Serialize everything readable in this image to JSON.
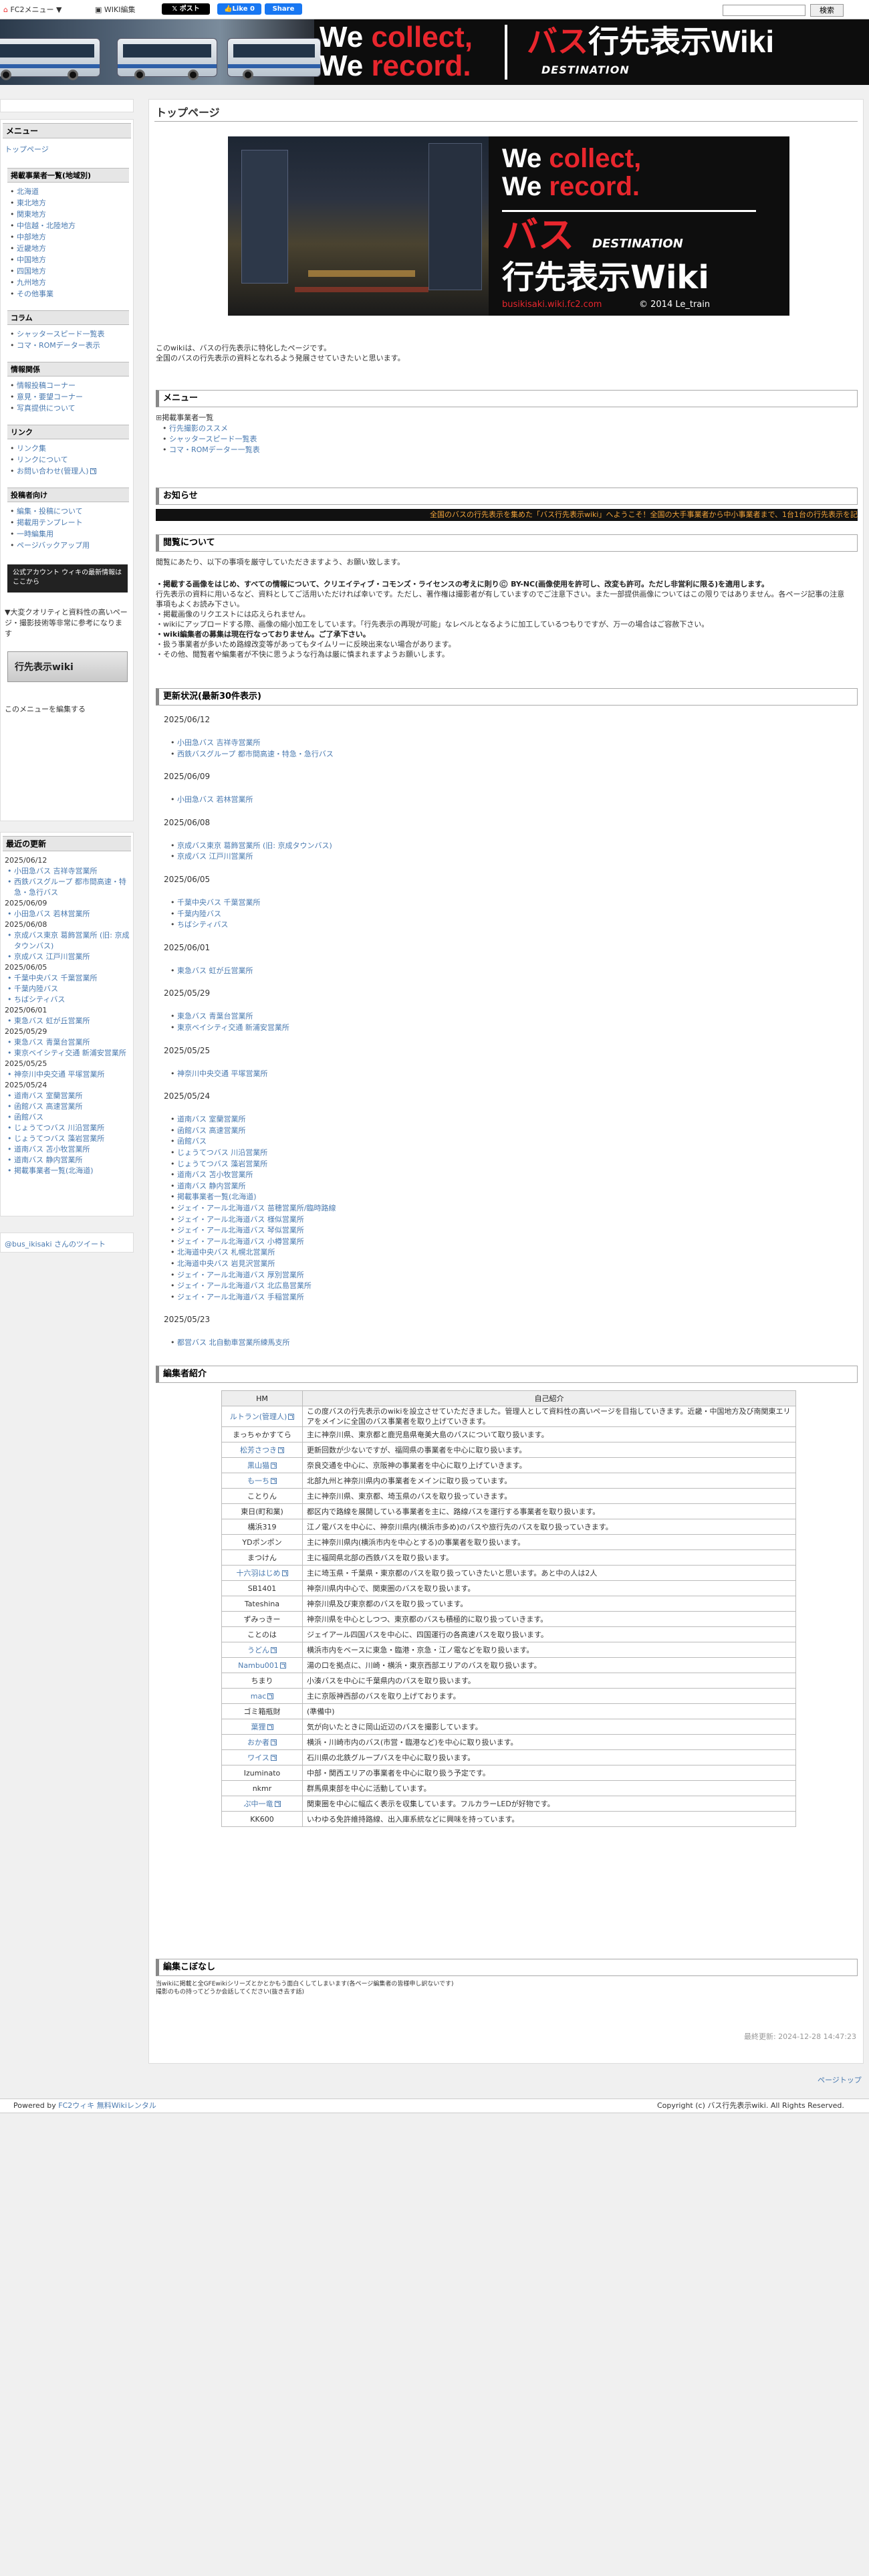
{
  "topbar": {
    "fc2_menu": "FC2メニュー ▼",
    "wiki_edit": "WIKI編集",
    "post_btn": "ポスト",
    "like_btn": "Like 0",
    "share_btn": "Share",
    "search_button": "検索"
  },
  "banner": {
    "line1a": "We ",
    "line1b": "collect,",
    "line2a": "We ",
    "line2b": "record.",
    "title1": "バス",
    "title2": "行先表示Wiki",
    "subtitle": "DESTINATION"
  },
  "sidebar": {
    "menu_heading": "メニュー",
    "top_link": "トップページ",
    "sec_region": "掲載事業者一覧(地域別)",
    "regions": [
      "北海道",
      "東北地方",
      "関東地方",
      "中信越・北陸地方",
      "中部地方",
      "近畿地方",
      "中国地方",
      "四国地方",
      "九州地方",
      "その他事業"
    ],
    "sec_column": "コラム",
    "columns": [
      "シャッタースピード一覧表",
      "コマ・ROMデーター表示"
    ],
    "sec_info": "情報関係",
    "info": [
      "情報投稿コーナー",
      "意見・要望コーナー",
      "写真提供について"
    ],
    "sec_link": "リンク",
    "links": [
      "リンク集",
      "リンクについて",
      "お問い合わせ(管理人)"
    ],
    "sec_edit": "投稿者向け",
    "edit": [
      "編集・投稿について",
      "掲載用テンプレート",
      "一時編集用",
      "ページバックアップ用"
    ],
    "twitter_banner": "公式アカウント ウィキの最新情報はここから",
    "quality_text": "▼大変クオリティと資料性の高いページ・撮影技術等非常に参考になります",
    "wiki_banner": "行先表示wiki",
    "edit_menu": "このメニューを編集する",
    "recent_heading": "最近の更新",
    "recent": [
      {
        "date": "2025/06/12",
        "items": [
          "小田急バス 吉祥寺営業所",
          "西鉄バスグループ 都市間高速・特急・急行バス"
        ]
      },
      {
        "date": "2025/06/09",
        "items": [
          "小田急バス 若林営業所"
        ]
      },
      {
        "date": "2025/06/08",
        "items": [
          "京成バス東京 葛飾営業所 (旧: 京成タウンバス)",
          "京成バス 江戸川営業所"
        ]
      },
      {
        "date": "2025/06/05",
        "items": [
          "千葉中央バス 千葉営業所",
          "千葉内陸バス",
          "ちばシティバス"
        ]
      },
      {
        "date": "2025/06/01",
        "items": [
          "東急バス 虹が丘営業所"
        ]
      },
      {
        "date": "2025/05/29",
        "items": [
          "東急バス 青葉台営業所",
          "東京ベイシティ交通 新浦安営業所"
        ]
      },
      {
        "date": "2025/05/25",
        "items": [
          "神奈川中央交通 平塚営業所"
        ]
      },
      {
        "date": "2025/05/24",
        "items": [
          "道南バス 室蘭営業所",
          "函館バス 高速営業所",
          "函館バス",
          "じょうてつバス 川沿営業所",
          "じょうてつバス 藻岩営業所",
          "道南バス 苫小牧営業所",
          "道南バス 静内営業所",
          "掲載事業者一覧(北海道)"
        ]
      }
    ],
    "tweets_link": "@bus_ikisaki さんのツイート"
  },
  "content": {
    "page_title": "トップページ",
    "credit": "busikisaki.wiki.fc2.com",
    "credit2": "© 2014 Le_train",
    "intro1": "このwikiは、バスの行先表示に特化したページです。",
    "intro2": "全国のバスの行先表示の資料となれるよう発展させていきたいと思います。",
    "menu_heading": "メニュー",
    "menu_items": [
      "掲載事業者一覧",
      "行先撮影のススメ",
      "シャッタースピード一覧表",
      "コマ・ROMデーター一覧表"
    ],
    "notice_heading": "お知らせ",
    "marquee": "全国のバスの行先表示を集めた「バス行先表示wiki」へようこそ！全国の大手事業者から中小事業者まで、1台1台の行先表示を記録しています。",
    "browse_heading": "閲覧について",
    "browse1": "閲覧にあたり、以下の事項を厳守していただきますよう、お願い致します。",
    "browse2": "・掲載する画像をはじめ、すべての情報について、クリエイティブ・コモンズ・ライセンスの考えに則り©️ BY-NC(画像使用を許可し、改変も許可。ただし非営利に限る)を適用します。",
    "browse2b": "行先表示の資料に用いるなど、資料としてご活用いただければ幸いです。ただし、著作権は撮影者が有していますのでご注意下さい。また一部提供画像についてはこの限りではありません。各ページ記事の注意事項もよくお読み下さい。",
    "browse3": "・掲載画像のリクエストには応えられません。",
    "browse4": "・wikiにアップロードする際、画像の縮小加工をしています。「行先表示の再現が可能」なレベルとなるように加工しているつもりですが、万一の場合はご容赦下さい。",
    "browse5": "・wiki編集者の募集は現在行なっておりません。ご了承下さい。",
    "browse6": "・扱う事業者が多いため路線改変等があってもタイムリーに反映出来ない場合があります。",
    "browse7": "・その他、閲覧者や編集者が不快に思うような行為は厳に慎まれますようお願いします。",
    "updates_heading": "更新状況(最新30件表示)",
    "updates": [
      {
        "date": "2025/06/12",
        "items": [
          "小田急バス 吉祥寺営業所",
          "西鉄バスグループ 都市間高速・特急・急行バス"
        ]
      },
      {
        "date": "2025/06/09",
        "items": [
          "小田急バス 若林営業所"
        ]
      },
      {
        "date": "2025/06/08",
        "items": [
          "京成バス東京 葛飾営業所 (旧: 京成タウンバス)",
          "京成バス 江戸川営業所"
        ]
      },
      {
        "date": "2025/06/05",
        "items": [
          "千葉中央バス 千葉営業所",
          "千葉内陸バス",
          "ちばシティバス"
        ]
      },
      {
        "date": "2025/06/01",
        "items": [
          "東急バス 虹が丘営業所"
        ]
      },
      {
        "date": "2025/05/29",
        "items": [
          "東急バス 青葉台営業所",
          "東京ベイシティ交通 新浦安営業所"
        ]
      },
      {
        "date": "2025/05/25",
        "items": [
          "神奈川中央交通 平塚営業所"
        ]
      },
      {
        "date": "2025/05/24",
        "items": [
          "道南バス 室蘭営業所",
          "函館バス 高速営業所",
          "函館バス",
          "じょうてつバス 川沿営業所",
          "じょうてつバス 藻岩営業所",
          "道南バス 苫小牧営業所",
          "道南バス 静内営業所",
          "掲載事業者一覧(北海道)",
          "ジェイ・アール北海道バス 苗穂営業所/臨時路線",
          "ジェイ・アール北海道バス 様似営業所",
          "ジェイ・アール北海道バス 琴似営業所",
          "ジェイ・アール北海道バス 小樽営業所",
          "北海道中央バス 札幌北営業所",
          "北海道中央バス 岩見沢営業所",
          "ジェイ・アール北海道バス 厚別営業所",
          "ジェイ・アール北海道バス 北広島営業所",
          "ジェイ・アール北海道バス 手稲営業所"
        ]
      },
      {
        "date": "2025/05/23",
        "items": [
          "都営バス 北自動車営業所練馬支所"
        ]
      }
    ],
    "editors_heading": "編集者紹介",
    "editors_head_name": "HM",
    "editors_head_intro": "自己紹介",
    "editors": [
      {
        "name": "ルトラン(管理人)",
        "link": true,
        "intro": "この度バスの行先表示のwikiを設立させていただきました。管理人として資料性の高いページを目指していきます。近畿・中国地方及び南関東エリアをメインに全国のバス事業者を取り上げていきます。"
      },
      {
        "name": "まっちゃかすてら",
        "link": false,
        "intro": "主に神奈川県、東京都と鹿児島県奄美大島のバスについて取り扱います。"
      },
      {
        "name": "松芳さつき",
        "link": true,
        "intro": "更新回数が少ないですが、福岡県の事業者を中心に取り扱います。"
      },
      {
        "name": "黒山猫",
        "link": true,
        "intro": "奈良交通を中心に、京阪神の事業者を中心に取り上げていきます。"
      },
      {
        "name": "も一ち",
        "link": true,
        "intro": "北部九州と神奈川県内の事業者をメインに取り扱っています。"
      },
      {
        "name": "ことりん",
        "link": false,
        "intro": "主に神奈川県、東京都、埼玉県のバスを取り扱っていきます。"
      },
      {
        "name": "東日(町和業)",
        "link": false,
        "intro": "都区内で路線を展開している事業者を主に、路線バスを運行する事業者を取り扱います。"
      },
      {
        "name": "構浜319",
        "link": false,
        "intro": "江ノ電バスを中心に、神奈川県内(横浜市多め)のバスや旅行先のバスを取り扱っていきます。"
      },
      {
        "name": "YDポンポン",
        "link": false,
        "intro": "主に神奈川県内(横浜市内を中心とする)の事業者を取り扱います。"
      },
      {
        "name": "まつけん",
        "link": false,
        "intro": "主に福岡県北部の西鉄バスを取り扱います。"
      },
      {
        "name": "十六羽はじめ",
        "link": true,
        "intro": "主に埼玉県・千葉県・東京都のバスを取り扱っていきたいと思います。あと中の人は2人"
      },
      {
        "name": "SB1401",
        "link": false,
        "intro": "神奈川県内中心で、関東圏のバスを取り扱います。"
      },
      {
        "name": "Tateshina",
        "link": false,
        "intro": "神奈川県及び東京都のバスを取り扱っています。"
      },
      {
        "name": "ずみっきー",
        "link": false,
        "intro": "神奈川県を中心としつつ、東京都のバスも積極的に取り扱っていきます。"
      },
      {
        "name": "ことのは",
        "link": false,
        "intro": "ジェイアール四国バスを中心に、四国運行の各高速バスを取り扱います。"
      },
      {
        "name": "うどん",
        "link": true,
        "intro": "横浜市内をベースに東急・臨港・京急・江ノ電などを取り扱います。"
      },
      {
        "name": "Nambu001",
        "link": true,
        "intro": "湯の口を拠点に、川崎・横浜・東京西部エリアのバスを取り扱います。"
      },
      {
        "name": "ちまり",
        "link": false,
        "intro": "小湊バスを中心に千葉県内のバスを取り扱います。"
      },
      {
        "name": "mac",
        "link": true,
        "intro": "主に京阪神西部のバスを取り上げております。"
      },
      {
        "name": "ゴミ箱瓶財",
        "link": false,
        "intro": "(準備中)"
      },
      {
        "name": "葉狸",
        "link": true,
        "intro": "気が向いたときに岡山近辺のバスを撮影しています。"
      },
      {
        "name": "おか者",
        "link": true,
        "intro": "横浜・川崎市内のバス(市営・臨港など)を中心に取り扱います。"
      },
      {
        "name": "ワイス",
        "link": true,
        "intro": "石川県の北鉄グループバスを中心に取り扱います。"
      },
      {
        "name": "Izuminato",
        "link": false,
        "intro": "中部・関西エリアの事業者を中心に取り扱う予定です。"
      },
      {
        "name": "nkmr",
        "link": false,
        "intro": "群馬県東部を中心に活動しています。"
      },
      {
        "name": "ぷ中一竜",
        "link": true,
        "intro": "関東圏を中心に幅広く表示を収集しています。フルカラーLEDが好物です。"
      },
      {
        "name": "KK600",
        "link": false,
        "intro": "いわゆる免許維持路線、出入庫系統などに興味を持っています。"
      }
    ],
    "kotoba_heading": "編集こぼなし",
    "kotoba1": "当wikiに掲載と全GFEwikiシリーズとかとかもう面白くしてしまいます(各ページ編集者の皆様申し訳ないです)",
    "kotoba2": "撮影のもの持ってどうか会話してください(抜き去す話)",
    "last_updated": "最終更新: 2024-12-28 14:47:23"
  },
  "page_top": "ページトップ",
  "footer": {
    "powered_by": "Powered by ",
    "fc2_link": "FC2ウィキ 無料Wikiレンタル",
    "copyright": "Copyright (c) バス行先表示wiki. All Rights Reserved."
  }
}
